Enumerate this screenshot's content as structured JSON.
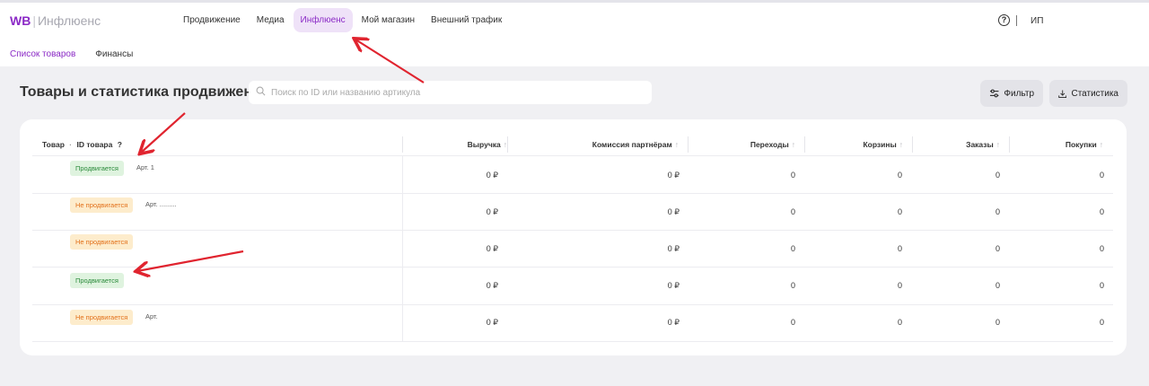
{
  "header": {
    "logo_brand": "WB",
    "logo_divider": "|",
    "logo_product": "Инфлюенс",
    "nav": [
      {
        "label": "Продвижение",
        "active": false
      },
      {
        "label": "Медиа",
        "active": false
      },
      {
        "label": "Инфлюенс",
        "active": true
      },
      {
        "label": "Мой магазин",
        "active": false
      },
      {
        "label": "Внешний трафик",
        "active": false
      }
    ],
    "help_icon": "?",
    "user_label": "ИП"
  },
  "subnav": [
    {
      "label": "Список товаров",
      "active": true
    },
    {
      "label": "Финансы",
      "active": false
    }
  ],
  "page": {
    "title": "Товары и статистика продвижения",
    "search_placeholder": "Поиск по ID или названию артикула",
    "filter_label": "Фильтр",
    "stats_label": "Статистика"
  },
  "table": {
    "product_header": "Товар",
    "dot": "·",
    "id_header": "ID товара",
    "id_help": "?",
    "columns": [
      {
        "label": "Выручка",
        "arrow": "↑"
      },
      {
        "label": "Комиссия партнёрам",
        "arrow": "↑"
      },
      {
        "label": "Переходы",
        "arrow": "↑"
      },
      {
        "label": "Корзины",
        "arrow": "↑"
      },
      {
        "label": "Заказы",
        "arrow": "↑"
      },
      {
        "label": "Покупки",
        "arrow": "↑"
      }
    ],
    "rows": [
      {
        "status": "Продвигается",
        "status_type": "on",
        "article": "Арт. 1",
        "values": [
          "0 ₽",
          "0 ₽",
          "0",
          "0",
          "0",
          "0"
        ]
      },
      {
        "status": "Не продвигается",
        "status_type": "off",
        "article": "Арт. .........",
        "values": [
          "0 ₽",
          "0 ₽",
          "0",
          "0",
          "0",
          "0"
        ]
      },
      {
        "status": "Не продвигается",
        "status_type": "off",
        "article": "",
        "values": [
          "0 ₽",
          "0 ₽",
          "0",
          "0",
          "0",
          "0"
        ]
      },
      {
        "status": "Продвигается",
        "status_type": "on",
        "article": "",
        "values": [
          "0 ₽",
          "0 ₽",
          "0",
          "0",
          "0",
          "0"
        ]
      },
      {
        "status": "Не продвигается",
        "status_type": "off",
        "article": "Арт.",
        "values": [
          "0 ₽",
          "0 ₽",
          "0",
          "0",
          "0",
          "0"
        ]
      }
    ]
  },
  "colors": {
    "accent": "#8b2ac6",
    "annotation_arrow": "#e0242f",
    "badge_on_bg": "#dff3df",
    "badge_off_bg": "#fdeccc"
  }
}
